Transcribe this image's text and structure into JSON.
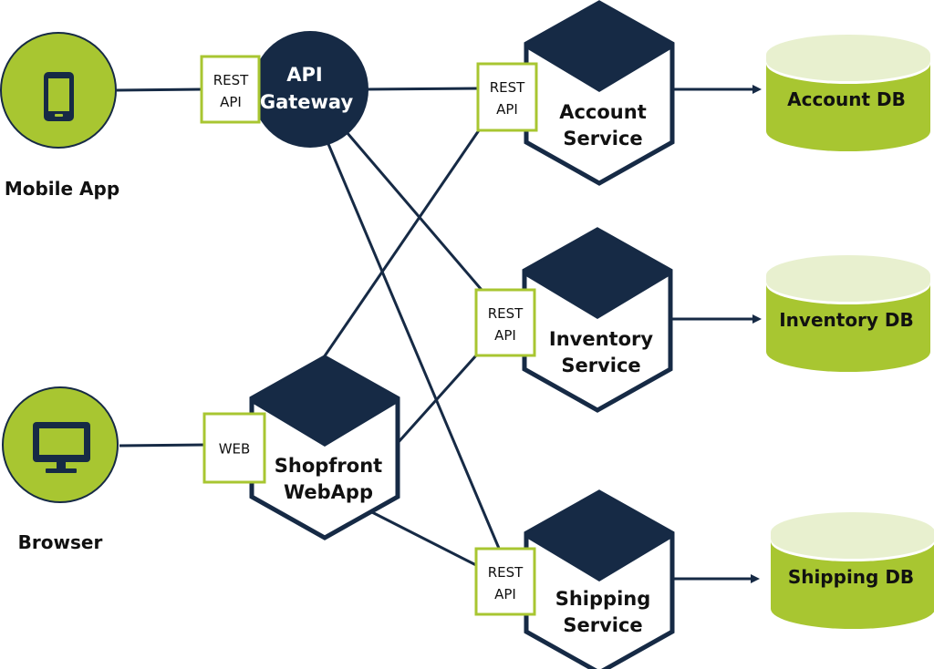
{
  "colors": {
    "navy": "#162a45",
    "green": "#a8c631",
    "green_light": "#e8f0cf",
    "port_border": "#a8c631",
    "text": "#111111"
  },
  "clients": [
    {
      "id": "mobile",
      "label": "Mobile App",
      "icon": "smartphone-icon"
    },
    {
      "id": "browser",
      "label": "Browser",
      "icon": "desktop-monitor-icon"
    }
  ],
  "gateway": {
    "id": "gateway",
    "label_line1": "API",
    "label_line2": "Gateway"
  },
  "webapp": {
    "id": "shopfront",
    "label_line1": "Shopfront",
    "label_line2": "WebApp"
  },
  "services": [
    {
      "id": "account",
      "label_line1": "Account",
      "label_line2": "Service"
    },
    {
      "id": "inventory",
      "label_line1": "Inventory",
      "label_line2": "Service"
    },
    {
      "id": "shipping",
      "label_line1": "Shipping",
      "label_line2": "Service"
    }
  ],
  "databases": [
    {
      "id": "account-db",
      "label": "Account DB"
    },
    {
      "id": "inventory-db",
      "label": "Inventory DB"
    },
    {
      "id": "shipping-db",
      "label": "Shipping DB"
    }
  ],
  "ports": {
    "gateway": {
      "line1": "REST",
      "line2": "API"
    },
    "account": {
      "line1": "REST",
      "line2": "API"
    },
    "inventory": {
      "line1": "REST",
      "line2": "API"
    },
    "shipping": {
      "line1": "REST",
      "line2": "API"
    },
    "shopfront": {
      "line1": "WEB"
    }
  },
  "connections": [
    {
      "from": "mobile",
      "to": "gateway-port"
    },
    {
      "from": "browser",
      "to": "shopfront-port"
    },
    {
      "from": "gateway",
      "to": "account-port"
    },
    {
      "from": "gateway",
      "to": "inventory-port"
    },
    {
      "from": "gateway",
      "to": "shipping-port"
    },
    {
      "from": "shopfront",
      "to": "account-port"
    },
    {
      "from": "shopfront",
      "to": "inventory-port"
    },
    {
      "from": "shopfront",
      "to": "shipping-port"
    },
    {
      "from": "account",
      "to": "account-db",
      "arrow": true
    },
    {
      "from": "inventory",
      "to": "inventory-db",
      "arrow": true
    },
    {
      "from": "shipping",
      "to": "shipping-db",
      "arrow": true
    }
  ]
}
